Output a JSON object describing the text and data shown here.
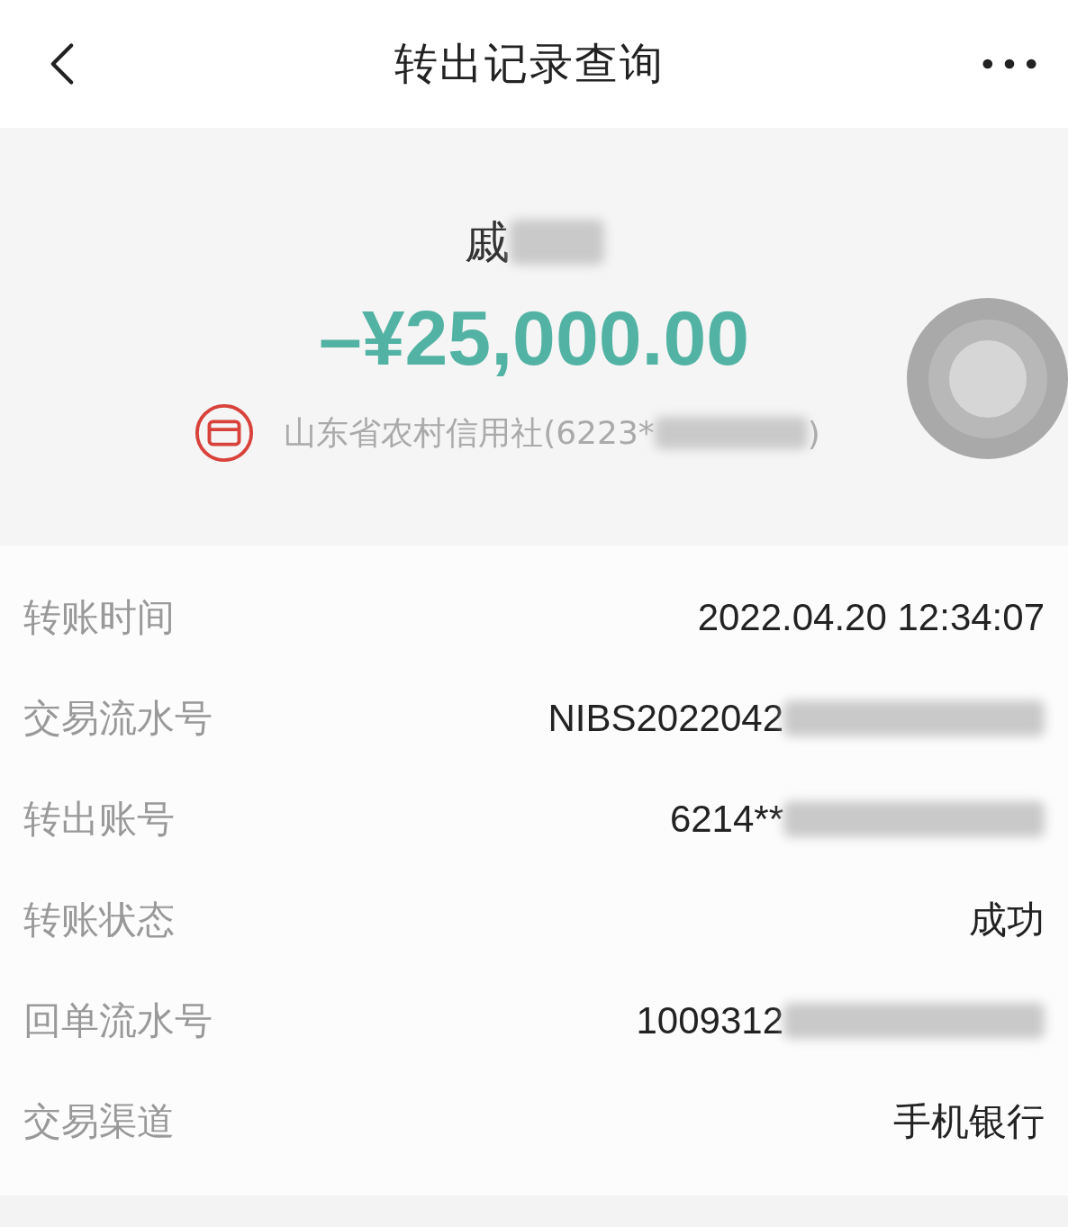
{
  "header": {
    "title": "转出记录查询"
  },
  "summary": {
    "payee": "戚",
    "payee_redacted": true,
    "amount": "–¥25,000.00",
    "bank": "山东省农村信用社(6223*",
    "bank_redacted": true,
    "bank_suffix": ")"
  },
  "details": [
    {
      "label": "转账时间",
      "value": "2022.04.20 12:34:07",
      "redacted": false
    },
    {
      "label": "交易流水号",
      "value": "NIBS2022042",
      "redacted": true
    },
    {
      "label": "转出账号",
      "value": "6214**",
      "redacted": true
    },
    {
      "label": "转账状态",
      "value": "成功",
      "redacted": false
    },
    {
      "label": "回单流水号",
      "value": "1009312",
      "redacted": true
    },
    {
      "label": "交易渠道",
      "value": "手机银行",
      "redacted": false
    }
  ]
}
